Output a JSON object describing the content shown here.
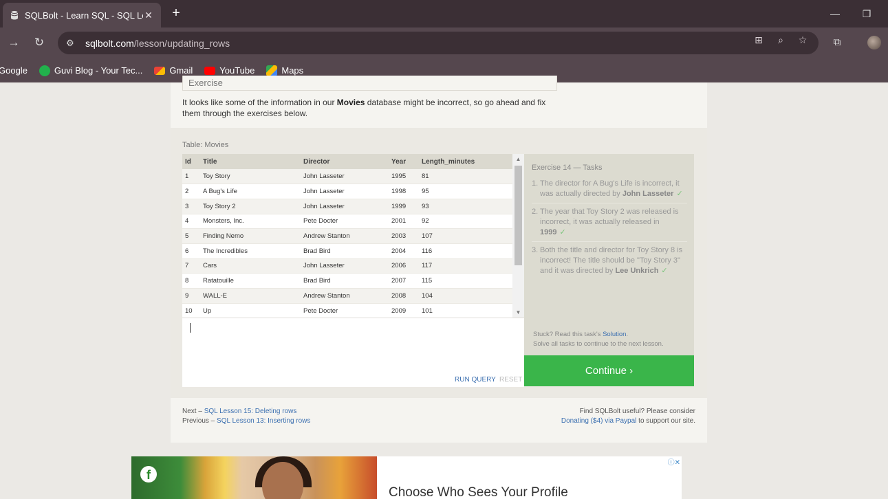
{
  "browser": {
    "tab_title": "SQLBolt - Learn SQL - SQL Less",
    "url_domain": "sqlbolt.com",
    "url_path": "/lesson/updating_rows",
    "bookmarks": [
      {
        "label": "Google",
        "color": "#4285f4"
      },
      {
        "label": "Guvi Blog - Your Tec...",
        "color": "#22b14c"
      },
      {
        "label": "Gmail",
        "color": "#ea4335"
      },
      {
        "label": "YouTube",
        "color": "#ff0000"
      },
      {
        "label": "Maps",
        "color": "#34a853"
      }
    ]
  },
  "exercise": {
    "header": "Exercise",
    "intro_pre": "It looks like some of the information in our ",
    "intro_bold": "Movies",
    "intro_post": " database might be incorrect, so go ahead and fix them through the exercises below.",
    "table_caption": "Table: Movies",
    "columns": [
      "Id",
      "Title",
      "Director",
      "Year",
      "Length_minutes"
    ],
    "rows": [
      [
        "1",
        "Toy Story",
        "John Lasseter",
        "1995",
        "81"
      ],
      [
        "2",
        "A Bug's Life",
        "John Lasseter",
        "1998",
        "95"
      ],
      [
        "3",
        "Toy Story 2",
        "John Lasseter",
        "1999",
        "93"
      ],
      [
        "4",
        "Monsters, Inc.",
        "Pete Docter",
        "2001",
        "92"
      ],
      [
        "5",
        "Finding Nemo",
        "Andrew Stanton",
        "2003",
        "107"
      ],
      [
        "6",
        "The Incredibles",
        "Brad Bird",
        "2004",
        "116"
      ],
      [
        "7",
        "Cars",
        "John Lasseter",
        "2006",
        "117"
      ],
      [
        "8",
        "Ratatouille",
        "Brad Bird",
        "2007",
        "115"
      ],
      [
        "9",
        "WALL-E",
        "Andrew Stanton",
        "2008",
        "104"
      ],
      [
        "10",
        "Up",
        "Pete Docter",
        "2009",
        "101"
      ]
    ],
    "run_label": "RUN QUERY",
    "reset_label": "RESET"
  },
  "tasks": {
    "heading": "Exercise 14 — Tasks",
    "items": [
      {
        "num": "1.",
        "text": "The director for A Bug's Life is incorrect, it was actually directed by ",
        "bold": "John Lasseter"
      },
      {
        "num": "2.",
        "text": "The year that Toy Story 2 was released is incorrect, it was actually released in ",
        "bold": "1999"
      },
      {
        "num": "3.",
        "text": "Both the title and director for Toy Story 8 is incorrect! The title should be \"Toy Story 3\" and it was directed by ",
        "bold": "Lee Unkrich"
      }
    ],
    "check_mark": "✓",
    "stuck_pre": "Stuck? Read this task's ",
    "stuck_link": "Solution",
    "stuck_post": ".",
    "solve_all": "Solve all tasks to continue to the next lesson.",
    "continue_label": "Continue ›"
  },
  "footer": {
    "next_prefix": "Next – ",
    "next_link": "SQL Lesson 15: Deleting rows",
    "prev_prefix": "Previous – ",
    "prev_link": "SQL Lesson 13: Inserting rows",
    "find_text": "Find SQLBolt useful? Please consider",
    "donate_link": "Donating ($4) via Paypal",
    "support_text": " to support our site."
  },
  "ad": {
    "headline": "Choose Who Sees Your Profile"
  }
}
